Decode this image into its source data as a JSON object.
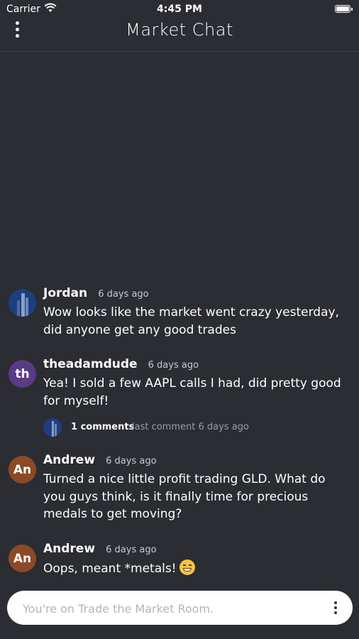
{
  "status_bar": {
    "carrier": "Carrier",
    "time": "4:45 PM"
  },
  "header": {
    "title": "Market Chat"
  },
  "messages": [
    {
      "author": "Jordan",
      "time": "6 days ago",
      "avatar": "photo",
      "text": "Wow looks like the market went crazy yesterday, did anyone get any good trades"
    },
    {
      "author": "theadamdude",
      "time": "6 days ago",
      "avatar_initials": "th",
      "text": "Yea! I sold a few AAPL calls I had, did pretty good for myself!",
      "comments": {
        "count_label": "1 comments",
        "last_label": "last comment 6 days ago"
      }
    },
    {
      "author": "Andrew",
      "time": "6 days ago",
      "avatar_initials": "An",
      "text": "Turned a nice little profit trading GLD. What do you guys think, is it finally time for precious medals to get moving?"
    },
    {
      "author": "Andrew",
      "time": "6 days ago",
      "avatar_initials": "An",
      "text": "Oops, meant *metals!",
      "emoji": "grinning-sweat-emoji"
    }
  ],
  "composer": {
    "placeholder": "You're on Trade the Market Room."
  },
  "colors": {
    "background": "#2b2d33",
    "purple_avatar": "#5b3a86",
    "brown_avatar": "#8b4a26"
  }
}
